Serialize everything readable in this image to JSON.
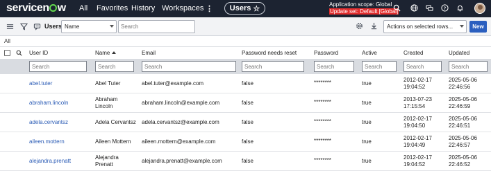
{
  "nav": {
    "brand": [
      "servicen",
      "w"
    ],
    "links": [
      "All",
      "Favorites",
      "History",
      "Workspaces"
    ],
    "more": "⋮",
    "tab_label": "Users",
    "tab_star": "☆",
    "scope_line": "Application scope: Global",
    "update_set": "Update set: Default [Global]"
  },
  "toolbar": {
    "list_title": "Users",
    "field_select": "Name",
    "search_placeholder": "Search",
    "actions_select": "Actions on selected rows...",
    "new_label": "New"
  },
  "breadcrumb": "All",
  "columns": [
    "User ID",
    "Name",
    "Email",
    "Password needs reset",
    "Password",
    "Active",
    "Created",
    "Updated"
  ],
  "search_placeholder": "Search",
  "rows": [
    {
      "user_id": "abel.tuter",
      "name": [
        "Abel Tuter",
        ""
      ],
      "email": "abel.tuter@example.com",
      "reset": "false",
      "password": "********",
      "active": "true",
      "created": [
        "2012-02-17",
        "19:04:52"
      ],
      "updated": [
        "2025-05-06",
        "22:46:56"
      ]
    },
    {
      "user_id": "abraham.lincoln",
      "name": [
        "Abraham",
        "Lincoln"
      ],
      "email": "abraham.lincoln@example.com",
      "reset": "false",
      "password": "********",
      "active": "true",
      "created": [
        "2013-07-23",
        "17:15:54"
      ],
      "updated": [
        "2025-05-06",
        "22:46:59"
      ]
    },
    {
      "user_id": "adela.cervantsz",
      "name": [
        "Adela Cervantsz",
        ""
      ],
      "email": "adela.cervantsz@example.com",
      "reset": "false",
      "password": "********",
      "active": "true",
      "created": [
        "2012-02-17",
        "19:04:50"
      ],
      "updated": [
        "2025-05-06",
        "22:46:51"
      ]
    },
    {
      "user_id": "aileen.mottern",
      "name": [
        "Aileen Mottern",
        ""
      ],
      "email": "aileen.mottern@example.com",
      "reset": "false",
      "password": "********",
      "active": "true",
      "created": [
        "2012-02-17",
        "19:04:49"
      ],
      "updated": [
        "2025-05-06",
        "22:46:57"
      ]
    },
    {
      "user_id": "alejandra.prenatt",
      "name": [
        "Alejandra",
        "Prenatt"
      ],
      "email": "alejandra.prenatt@example.com",
      "reset": "false",
      "password": "********",
      "active": "true",
      "created": [
        "2012-02-17",
        "19:04:52"
      ],
      "updated": [
        "2025-05-06",
        "22:46:52"
      ]
    }
  ],
  "colors": {
    "nav_bg": "#1c2331",
    "brand_green": "#62d84e",
    "update_set_red": "#e22d2d",
    "link": "#2a5bb5",
    "primary": "#2b5fbf"
  }
}
